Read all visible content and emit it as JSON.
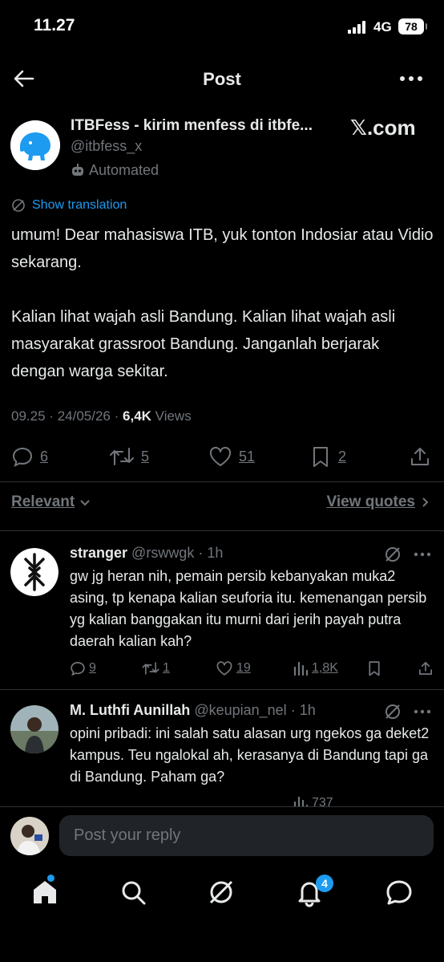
{
  "status_bar": {
    "time": "11.27",
    "network": "4G",
    "battery": "78"
  },
  "nav": {
    "title": "Post"
  },
  "post": {
    "author_name": "ITBFess - kirim menfess di itbfe...",
    "handle": "@itbfess_x",
    "badge": "Automated",
    "brand": "𝕏.com",
    "translate_label": "Show translation",
    "paragraphs": [
      "umum! Dear mahasiswa ITB, yuk tonton Indosiar atau Vidio sekarang.",
      "Kalian lihat wajah asli Bandung. Kalian lihat wajah asli masyarakat grassroot Bandung. Janganlah berjarak dengan warga sekitar."
    ],
    "time": "09.25",
    "date": "24/05/26",
    "separator": "·",
    "views_count": "6,4K",
    "views_label": "Views",
    "stats": {
      "replies": "6",
      "reposts": "5",
      "likes": "51",
      "bookmarks": "2"
    }
  },
  "sort": {
    "label": "Relevant",
    "quotes_label": "View quotes"
  },
  "replies": [
    {
      "name": "stranger",
      "handle": "@rswwgk",
      "time": "· 1h",
      "text": "gw jg heran nih, pemain persib kebanyakan muka2 asing, tp kenapa kalian seuforia itu. kemenangan persib yg kalian banggakan itu murni dari jerih payah putra daerah kalian kah?",
      "replies": "9",
      "reposts": "1",
      "likes": "19",
      "views": "1,8K"
    },
    {
      "name": "M. Luthfi Aunillah",
      "handle": "@keupian_nel",
      "time": "· 1h",
      "text": "opini pribadi: ini salah satu alasan urg ngekos ga deket2 kampus. Teu ngalokal ah, kerasanya di Bandung tapi ga di Bandung. Paham ga?",
      "views": "737"
    }
  ],
  "composer": {
    "placeholder": "Post your reply"
  },
  "tabbar": {
    "notification_count": "4"
  },
  "colors": {
    "accent": "#1d9bf0",
    "background": "#000000",
    "text": "#e7e9ea",
    "muted": "#71767b"
  }
}
